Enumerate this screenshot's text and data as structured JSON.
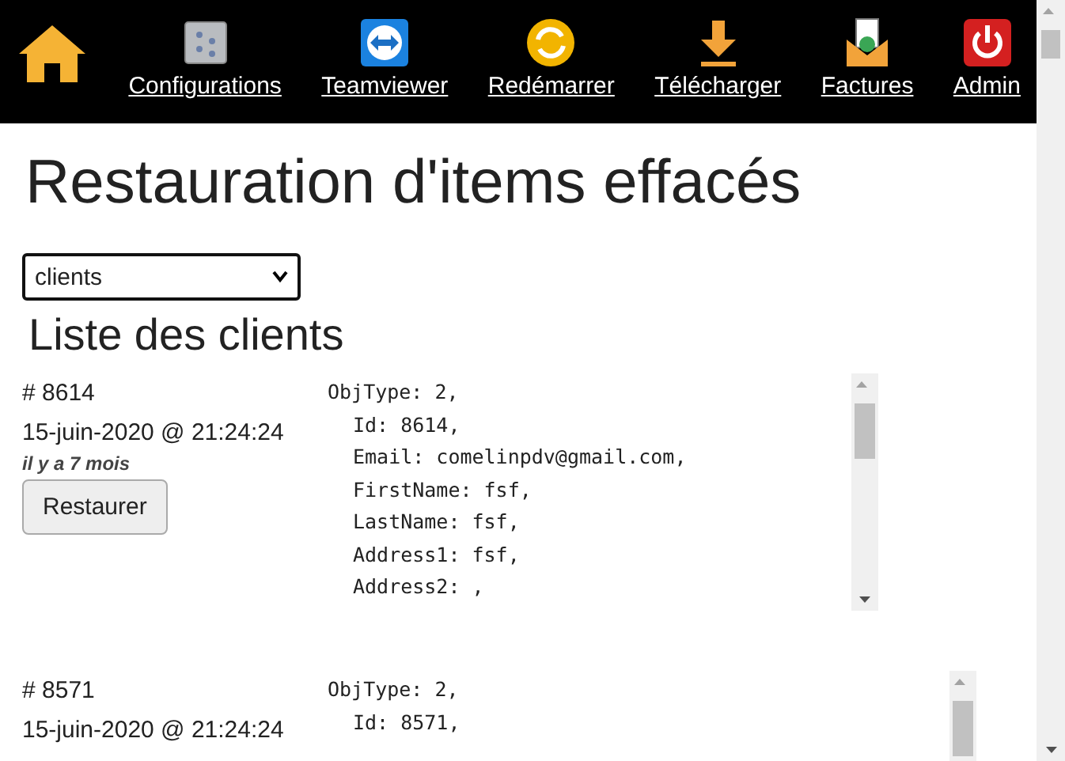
{
  "nav": {
    "home": {
      "kind": "home"
    },
    "items": [
      {
        "label": "Configurations",
        "kind": "settings"
      },
      {
        "label": "Teamviewer",
        "kind": "remote"
      },
      {
        "label": "Redémarrer",
        "kind": "restart"
      },
      {
        "label": "Télécharger",
        "kind": "download"
      },
      {
        "label": "Factures",
        "kind": "invoice"
      },
      {
        "label": "Admin",
        "kind": "power"
      }
    ]
  },
  "title": "Restauration d'items effacés",
  "select": {
    "value": "clients"
  },
  "list_title": "Liste des clients",
  "records": [
    {
      "id": "# 8614",
      "date": "15-juin-2020 @ 21:24:24",
      "ago": "il y a 7 mois",
      "button": "Restaurer",
      "lines": [
        "ObjType: 2,",
        "Id: 8614,",
        "Email: comelinpdv@gmail.com,",
        "FirstName: fsf,",
        "LastName: fsf,",
        "Address1: fsf,",
        "Address2: ,"
      ]
    },
    {
      "id": "# 8571",
      "date": "15-juin-2020 @ 21:24:24",
      "lines": [
        "ObjType: 2,",
        "Id: 8571,"
      ]
    }
  ]
}
